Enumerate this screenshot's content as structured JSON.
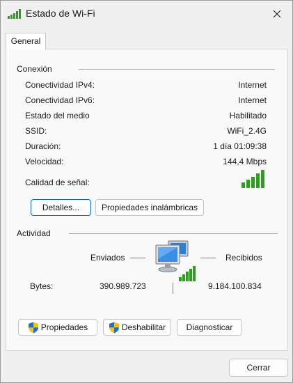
{
  "window": {
    "title": "Estado de Wi-Fi",
    "close_label": "Cerrar ventana"
  },
  "tabs": [
    {
      "label": "General",
      "selected": true
    }
  ],
  "connection": {
    "heading": "Conexión",
    "rows": [
      {
        "label": "Conectividad IPv4:",
        "value": "Internet"
      },
      {
        "label": "Conectividad IPv6:",
        "value": "Internet"
      },
      {
        "label": "Estado del medio",
        "value": "Habilitado"
      },
      {
        "label": "SSID:",
        "value": "WiFi_2.4G"
      },
      {
        "label": "Duración:",
        "value": "1 día 01:09:38"
      },
      {
        "label": "Velocidad:",
        "value": "144,4 Mbps"
      }
    ],
    "signal_label": "Calidad de señal:",
    "signal_bars": 5,
    "signal_bars_total": 5,
    "details_button": "Detalles...",
    "wireless_properties_button": "Propiedades inalámbricas"
  },
  "activity": {
    "heading": "Actividad",
    "sent_label": "Enviados",
    "received_label": "Recibidos",
    "bytes_label": "Bytes:",
    "bytes_sent": "390.989.723",
    "bytes_received": "9.184.100.834"
  },
  "actions": {
    "properties_button": "Propiedades",
    "disable_button": "Deshabilitar",
    "diagnose_button": "Diagnosticar"
  },
  "footer": {
    "close_button": "Cerrar"
  },
  "colors": {
    "accent": "#0067c0",
    "signal_green": "#2e9e1f",
    "shield_blue": "#1f6fd1",
    "shield_yellow": "#f2c21b"
  },
  "icons": {
    "title": "wifi-signal-icon",
    "close": "close-icon",
    "shield": "uac-shield-icon",
    "network": "network-computer-icon"
  }
}
